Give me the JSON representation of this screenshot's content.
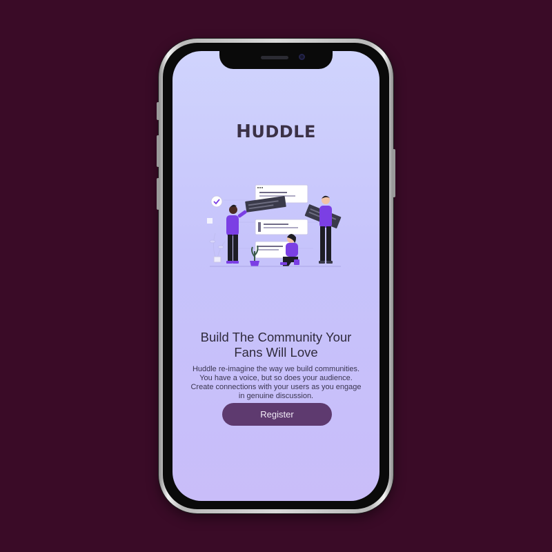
{
  "app": {
    "logo": "HUDDLE",
    "logo_first": "H",
    "logo_rest": "UDDLE"
  },
  "hero": {
    "headline": "Build The Community Your Fans Will Love",
    "description": "Huddle re-imagine the way we build communities. You have a voice, but so does your audience. Create connections with your users as you engage in genuine discussion.",
    "illustration_icon": "team-chat-illustration"
  },
  "cta": {
    "register_label": "Register"
  },
  "colors": {
    "page_background": "#3a0b27",
    "screen_top": "#d0d4fd",
    "screen_bottom": "#c9bdf9",
    "button": "#5e3a6f",
    "accent_purple": "#7b3fe4",
    "text_dark": "#2f2a3c"
  }
}
